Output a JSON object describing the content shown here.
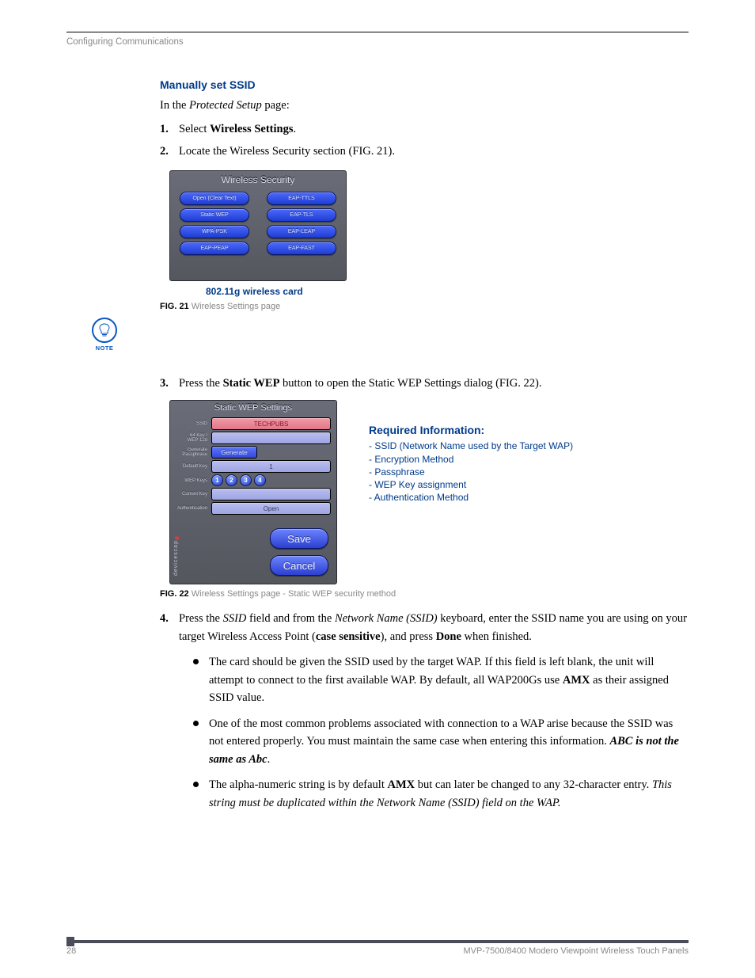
{
  "header": "Configuring Communications",
  "section_title": "Manually set SSID",
  "intro": {
    "a": "In the ",
    "b": "Protected Setup",
    "c": " page:"
  },
  "steps": {
    "s1": {
      "num": "1.",
      "a": "Select ",
      "b": "Wireless Settings",
      "c": "."
    },
    "s2": {
      "num": "2.",
      "a": "Locate the Wireless Security section (FIG. 21)."
    },
    "s3": {
      "num": "3.",
      "a": "Press the ",
      "b": "Static WEP",
      "c": " button to open the Static WEP Settings dialog (FIG. 22)."
    },
    "s4": {
      "num": "4.",
      "a": "Press the ",
      "b": "SSID",
      "c": " field and from the ",
      "d": "Network Name (SSID)",
      "e": " keyboard, enter the SSID name you are using on your target Wireless Access Point (",
      "f": "case sensitive",
      "g": "), and press ",
      "h": "Done",
      "i": " when finished."
    }
  },
  "bullets": {
    "b1": {
      "a": "The card should be given the SSID used by the target WAP. If this field is left blank, the unit will attempt to connect to the first available WAP. By default, all WAP200Gs use ",
      "b": "AMX",
      "c": " as their assigned SSID value."
    },
    "b2": {
      "a": "One of the most common problems associated with connection to a WAP arise because the SSID was not entered properly. You must maintain the same case when entering this information. ",
      "b": "ABC is not the same as Abc",
      "c": "."
    },
    "b3": {
      "a": "The alpha-numeric string is by default ",
      "b": "AMX",
      "c": " but can later be changed to any 32-character entry. ",
      "d": "This string must be duplicated within the Network Name (SSID) field on the WAP."
    }
  },
  "fig21": {
    "panel_title": "Wireless Security",
    "buttons": {
      "r1a": "Open (Clear Text)",
      "r1b": "EAP-TTLS",
      "r2a": "Static WEP",
      "r2b": "EAP-TLS",
      "r3a": "WPA-PSK",
      "r3b": "EAP-LEAP",
      "r4a": "EAP-PEAP",
      "r4b": "EAP-FAST"
    },
    "subcap": "802.11g wireless card",
    "label_num": "FIG. 21",
    "label_text": "Wireless Settings page"
  },
  "note_label": "NOTE",
  "fig22": {
    "panel_title": "Static WEP Settings",
    "labels": {
      "ssid": "SSID",
      "wep128": "64 Key /\nWEP 128",
      "gen": "Generate\nPassphrase",
      "defkey": "Default Key",
      "wepkeys": "WEP Keys",
      "curkey": "Current Key",
      "auth": "Authentication"
    },
    "values": {
      "ssid": "TECHPUBS",
      "gen": "Generate",
      "defkey": "1",
      "k1": "1",
      "k2": "2",
      "k3": "3",
      "k4": "4",
      "auth": "Open",
      "save": "Save",
      "cancel": "Cancel"
    },
    "devscape_a": "devicescap",
    "devscape_e": "e",
    "label_num": "FIG. 22",
    "label_text": "Wireless Settings page - Static WEP security method"
  },
  "reqinfo": {
    "title": "Required Information:",
    "i1": "- SSID (Network Name used by the Target WAP)",
    "i2": "- Encryption Method",
    "i3": "- Passphrase",
    "i4": "- WEP Key assignment",
    "i5": "- Authentication Method"
  },
  "footer": {
    "page": "28",
    "title": "MVP-7500/8400 Modero Viewpoint Wireless Touch Panels"
  }
}
